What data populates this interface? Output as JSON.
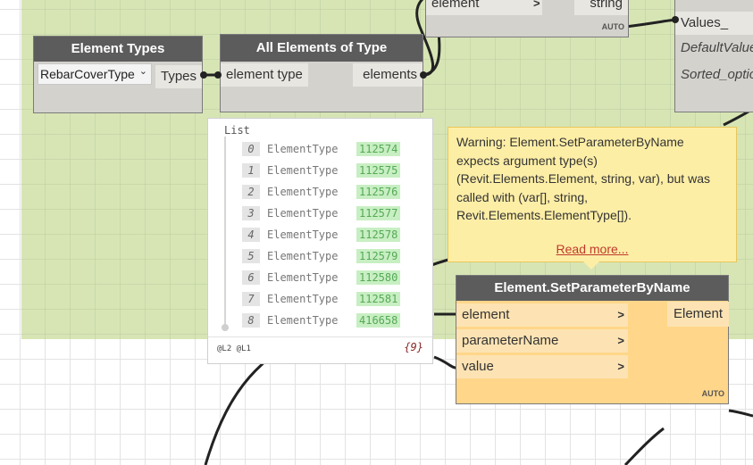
{
  "nodes": {
    "element_types": {
      "title": "Element Types",
      "dropdown_value": "RebarCoverType",
      "output_port": "Types"
    },
    "all_elements_of_type": {
      "title": "All Elements of Type",
      "input_port": "element type",
      "output_port": "elements"
    },
    "top_partial": {
      "input_port": "element",
      "input_port2": "string",
      "auto_label": "AUTO"
    },
    "right_partial": {
      "ports": [
        "Values_",
        "DefaultValue",
        "Sorted_optio"
      ]
    },
    "set_parameter": {
      "title": "Element.SetParameterByName",
      "inputs": [
        "element",
        "parameterName",
        "value"
      ],
      "output": "Element",
      "auto_label": "AUTO"
    }
  },
  "preview": {
    "title": "List",
    "items": [
      {
        "index": "0",
        "type": "ElementType",
        "value": "112574"
      },
      {
        "index": "1",
        "type": "ElementType",
        "value": "112575"
      },
      {
        "index": "2",
        "type": "ElementType",
        "value": "112576"
      },
      {
        "index": "3",
        "type": "ElementType",
        "value": "112577"
      },
      {
        "index": "4",
        "type": "ElementType",
        "value": "112578"
      },
      {
        "index": "5",
        "type": "ElementType",
        "value": "112579"
      },
      {
        "index": "6",
        "type": "ElementType",
        "value": "112580"
      },
      {
        "index": "7",
        "type": "ElementType",
        "value": "112581"
      },
      {
        "index": "8",
        "type": "ElementType",
        "value": "416658"
      }
    ],
    "levels": "@L2 @L1",
    "count": "{9}"
  },
  "warning": {
    "line1": "Warning: Element.SetParameterByName",
    "line2": "expects argument type(s)",
    "line3": "(Revit.Elements.Element, string, var), but was",
    "line4": "called with (var[], string,",
    "line5": "Revit.Elements.ElementType[]).",
    "link": "Read more..."
  },
  "icons": {
    "dropdown": "chevron-down-icon",
    "port_arrow": "chevron-right-icon"
  },
  "colors": {
    "group_background": "#d7e5b5",
    "node_header": "#5c5c5c",
    "warning_node": "#ffd68a",
    "warning_bubble": "#fdeea6",
    "preview_value": "#c8efc3"
  }
}
